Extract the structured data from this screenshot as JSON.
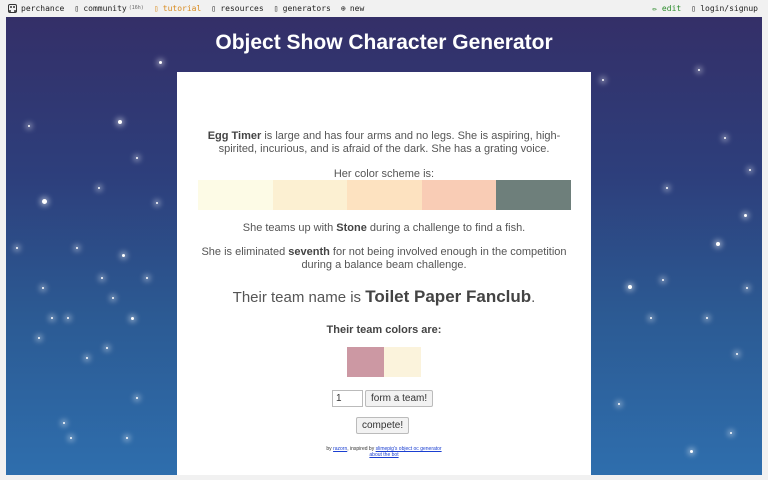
{
  "topbar": {
    "brand": "perchance",
    "items": [
      {
        "icon": "people-icon",
        "label": "community",
        "count": "(16h)"
      },
      {
        "icon": "book-icon",
        "label": "tutorial"
      },
      {
        "icon": "folder-icon",
        "label": "resources"
      },
      {
        "icon": "gear-icon",
        "label": "generators"
      },
      {
        "icon": "plus-circle-icon",
        "label": "new"
      }
    ],
    "edit": "✏ edit",
    "login": "login/signup"
  },
  "colors": {
    "accent": "#d98b20",
    "edit": "#2c8c2c",
    "link": "#1a3fd1"
  },
  "page": {
    "title": "Object Show Character Generator"
  },
  "character": {
    "name": "Egg Timer",
    "description": " is large and has four arms and no legs. She is aspiring, high-spirited, incurious, and is afraid of the dark. She has a grating voice.",
    "scheme_label": "Her color scheme is:",
    "scheme": [
      "#fdfbe6",
      "#fcf0d2",
      "#fde2c0",
      "#f9ccb5",
      "#6e7f7b"
    ],
    "teams_before": "She teams up with ",
    "teammate": "Stone",
    "teams_after": " during a challenge to find a fish.",
    "elim_before": "She is eliminated ",
    "elim_place": "seventh",
    "elim_after": " for not being involved enough in the competition during a balance beam challenge."
  },
  "team": {
    "name_prefix": "Their team name is ",
    "name": "Toilet Paper Fanclub",
    "name_suffix": ".",
    "colors_label": "Their team colors are:",
    "colors": [
      "#cc98a3",
      "#fbf3dc"
    ]
  },
  "form": {
    "count_value": "1",
    "form_button": "form a team!",
    "compete_button": "compete!"
  },
  "footer": {
    "by": "by ",
    "author": "razorn",
    "inspired": ", inspired by ",
    "inspiration": "slimepig's object oc generator",
    "about": "about the bot"
  }
}
